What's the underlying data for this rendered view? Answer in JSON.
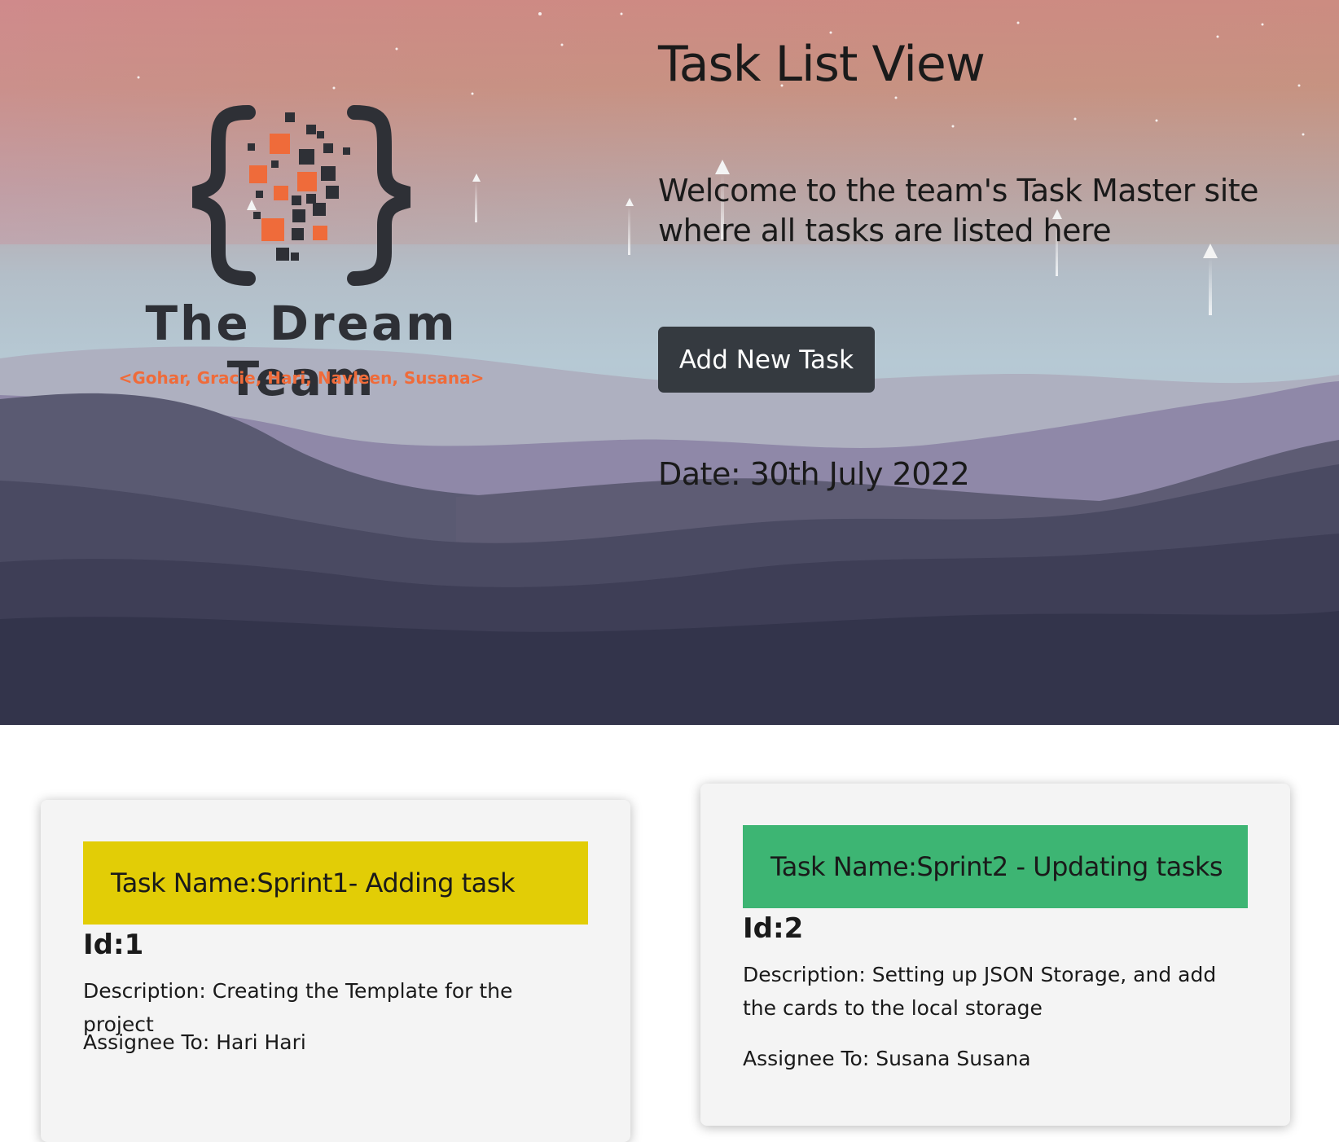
{
  "logo": {
    "team_name": "The Dream Team",
    "members": "<Gohar, Gracie, Hari, Navleen, Susana>"
  },
  "header": {
    "title": "Task List View",
    "welcome": "Welcome to the team's Task Master site where all tasks are listed here",
    "add_button_label": "Add New Task",
    "date": "Date: 30th July 2022"
  },
  "tasks": [
    {
      "name": "Task Name:Sprint1- Adding task",
      "id": "Id:1",
      "description": "Description: Creating the Template for the project",
      "assignee": "Assignee To: Hari Hari",
      "header_color": "#e2cd06"
    },
    {
      "name": "Task Name:Sprint2 - Updating tasks",
      "id": "Id:2",
      "description": "Description: Setting up JSON Storage, and add the cards to the local storage",
      "assignee": "Assignee To: Susana Susana",
      "header_color": "#3db573"
    }
  ],
  "colors": {
    "button_bg": "#353a40",
    "logo_accent": "#ef6b3a",
    "logo_dark": "#2e3036"
  }
}
